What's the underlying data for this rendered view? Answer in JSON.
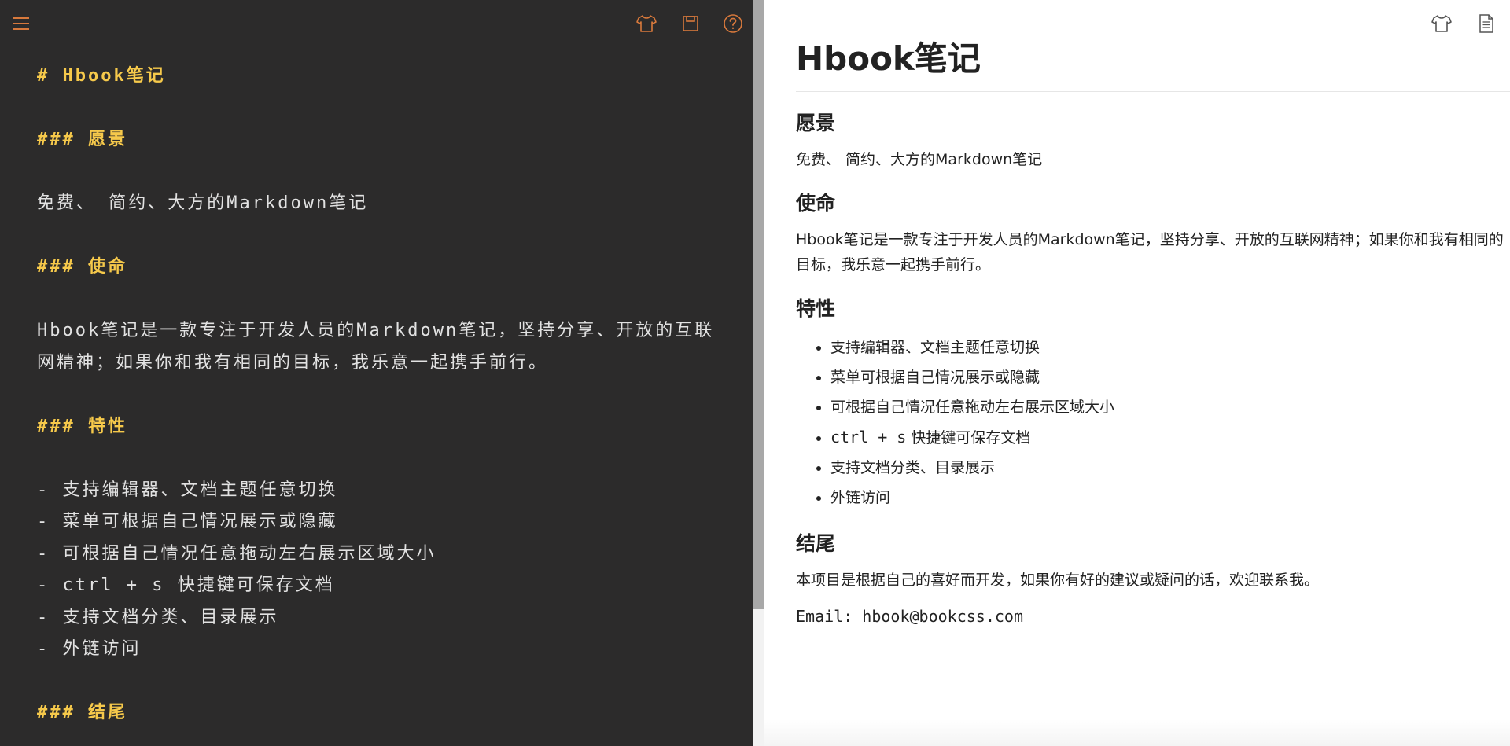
{
  "colors": {
    "editor_bg": "#2c2b2b",
    "editor_text": "#e2e2e2",
    "heading_accent": "#f6c94b",
    "icon_accent": "#d8793c",
    "preview_text": "#222222"
  },
  "editor": {
    "toolbar": {
      "menu_icon": "menu-icon",
      "theme_icon": "tshirt-icon",
      "save_icon": "save-icon",
      "help_icon": "help-circle-icon"
    },
    "lines": {
      "h1": "# Hbook笔记",
      "vision_heading": "### 愿景",
      "vision_text": "免费、 简约、大方的Markdown笔记",
      "mission_heading": "### 使命",
      "mission_text": "Hbook笔记是一款专注于开发人员的Markdown笔记，坚持分享、开放的互联网精神；如果你和我有相同的目标，我乐意一起携手前行。",
      "features_heading": "### 特性",
      "feature_items": [
        "- 支持编辑器、文档主题任意切换",
        "- 菜单可根据自己情况展示或隐藏",
        "- 可根据自己情况任意拖动左右展示区域大小",
        "- ctrl + s 快捷键可保存文档",
        "- 支持文档分类、目录展示",
        "- 外链访问"
      ],
      "ending_heading": "### 结尾"
    }
  },
  "preview": {
    "toolbar": {
      "theme_icon": "tshirt-icon",
      "doc_icon": "document-icon"
    },
    "title": "Hbook笔记",
    "sections": {
      "vision": {
        "heading": "愿景",
        "text": "免费、 简约、大方的Markdown笔记"
      },
      "mission": {
        "heading": "使命",
        "text": "Hbook笔记是一款专注于开发人员的Markdown笔记，坚持分享、开放的互联网精神；如果你和我有相同的目标，我乐意一起携手前行。"
      },
      "features": {
        "heading": "特性",
        "items": [
          "支持编辑器、文档主题任意切换",
          "菜单可根据自己情况展示或隐藏",
          "可根据自己情况任意拖动左右展示区域大小",
          "快捷键可保存文档",
          "支持文档分类、目录展示",
          "外链访问"
        ],
        "shortcut_code": "ctrl + s"
      },
      "ending": {
        "heading": "结尾",
        "text": "本项目是根据自己的喜好而开发，如果你有好的建议或疑问的话，欢迎联系我。",
        "email": "Email: hbook@bookcss.com"
      }
    }
  }
}
